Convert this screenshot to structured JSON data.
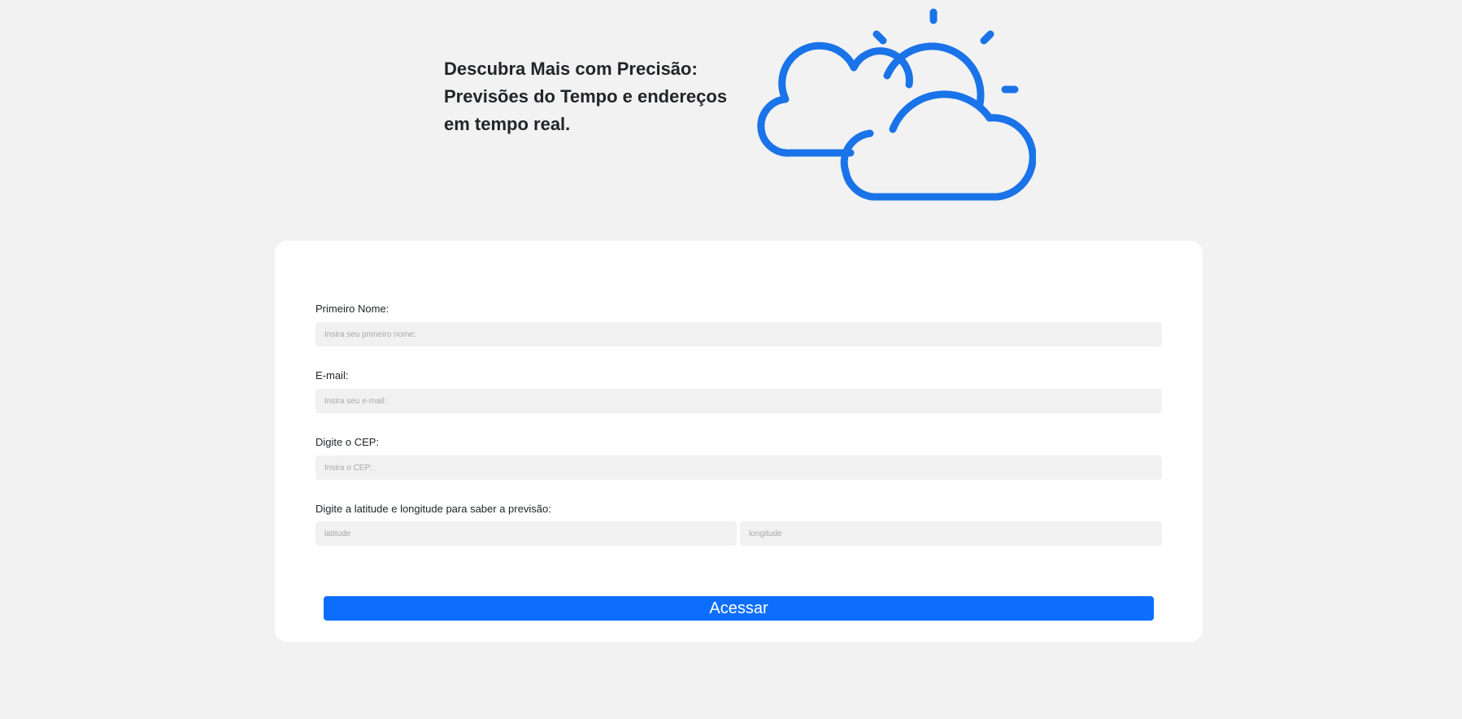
{
  "hero": {
    "title_lines": [
      "Descubra Mais com Precisão:",
      "Previsões do Tempo e endereços",
      "em tempo real."
    ],
    "icon": "sun-behind-clouds-icon",
    "icon_color": "#1a73e8"
  },
  "form": {
    "first_name": {
      "label": "Primeiro Nome:",
      "placeholder": "Insira seu primeiro nome:",
      "value": ""
    },
    "email": {
      "label": "E-mail:",
      "placeholder": "Insira seu e-mail:",
      "value": ""
    },
    "cep": {
      "label": "Digite o CEP:",
      "placeholder": "Insira o CEP:",
      "value": ""
    },
    "coordinates": {
      "label": "Digite a latitude e longitude para saber a previsão:",
      "latitude_placeholder": "latitude",
      "longitude_placeholder": "longitude"
    },
    "submit_label": "Acessar"
  },
  "colors": {
    "background": "#f2f2f2",
    "card": "#ffffff",
    "input_background": "#f1f1f1",
    "accent": "#0d6efd",
    "text": "#212529"
  }
}
